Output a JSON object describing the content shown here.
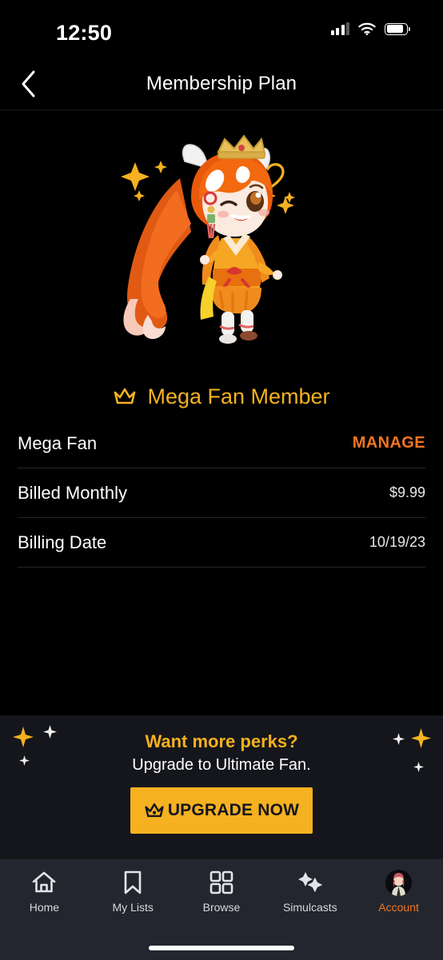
{
  "status_bar": {
    "time": "12:50",
    "signal_icon": "cellular-signal-icon",
    "wifi_icon": "wifi-icon",
    "battery_icon": "battery-icon"
  },
  "header": {
    "back_icon": "chevron-left-icon",
    "title": "Membership Plan"
  },
  "hero": {
    "mascot_icon": "crunchyroll-hime-mascot",
    "crown_icon": "crown-icon",
    "member_title": "Mega Fan Member"
  },
  "details": {
    "rows": [
      {
        "label": "Mega Fan",
        "value": "MANAGE",
        "action": true
      },
      {
        "label": "Billed Monthly",
        "value": "$9.99",
        "action": false
      },
      {
        "label": "Billing Date",
        "value": "10/19/23",
        "action": false
      }
    ]
  },
  "promo": {
    "title": "Want more perks?",
    "subtitle": "Upgrade to Ultimate Fan.",
    "button_label": "UPGRADE NOW",
    "button_icon": "crown-icon",
    "decor_icon": "sparkle-star-icon"
  },
  "tabbar": {
    "items": [
      {
        "label": "Home",
        "icon": "home-icon",
        "active": false
      },
      {
        "label": "My Lists",
        "icon": "bookmark-icon",
        "active": false
      },
      {
        "label": "Browse",
        "icon": "grid-icon",
        "active": false
      },
      {
        "label": "Simulcasts",
        "icon": "sparkles-icon",
        "active": false
      },
      {
        "label": "Account",
        "icon": "avatar-icon",
        "active": true
      }
    ]
  },
  "colors": {
    "background": "#000000",
    "accent_orange": "#F47521",
    "accent_gold": "#F5B120",
    "promo_bg": "#15161B",
    "tabbar_bg": "#23262E",
    "divider": "#262626"
  }
}
